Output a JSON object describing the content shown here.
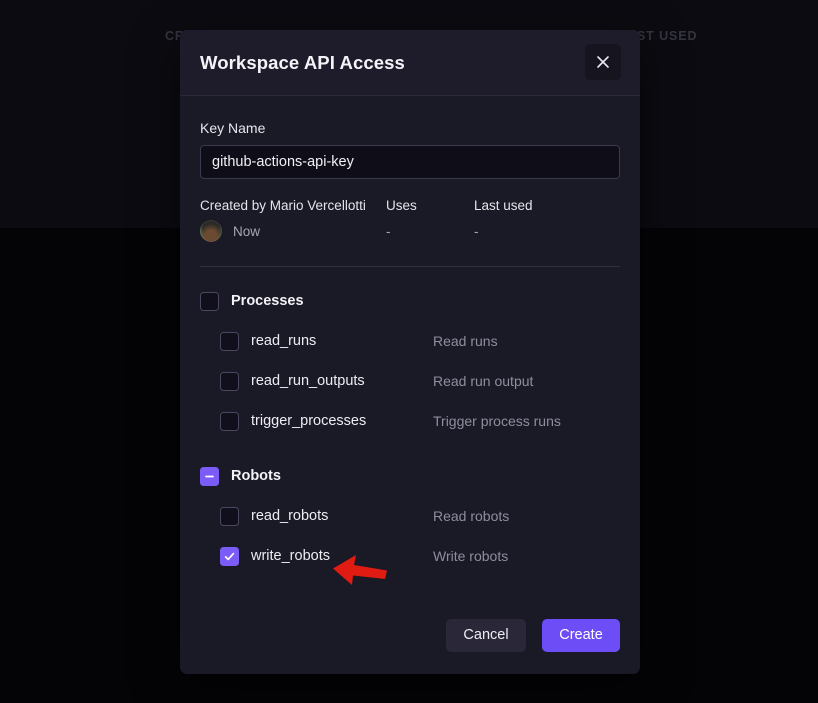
{
  "background": {
    "column_headers": [
      {
        "text": "CR",
        "name": "bg-column-created"
      },
      {
        "text": "AST USED",
        "name": "bg-column-last-used"
      }
    ]
  },
  "modal": {
    "title": "Workspace API Access",
    "close_icon": "close-icon",
    "key_name": {
      "label": "Key Name",
      "value": "github-actions-api-key",
      "placeholder": "Key Name"
    },
    "meta": {
      "created_by_label": "Created by Mario Vercellotti",
      "created_value": "Now",
      "uses_label": "Uses",
      "uses_value": "-",
      "last_used_label": "Last used",
      "last_used_value": "-"
    },
    "groups": [
      {
        "name": "Processes",
        "state": "unchecked",
        "permissions": [
          {
            "name": "read_runs",
            "description": "Read runs",
            "state": "unchecked"
          },
          {
            "name": "read_run_outputs",
            "description": "Read run output",
            "state": "unchecked"
          },
          {
            "name": "trigger_processes",
            "description": "Trigger process runs",
            "state": "unchecked"
          }
        ]
      },
      {
        "name": "Robots",
        "state": "indeterminate",
        "permissions": [
          {
            "name": "read_robots",
            "description": "Read robots",
            "state": "unchecked"
          },
          {
            "name": "write_robots",
            "description": "Write robots",
            "state": "checked"
          }
        ]
      }
    ],
    "footer": {
      "cancel_label": "Cancel",
      "create_label": "Create"
    }
  },
  "annotation": {
    "arrow_color": "#e01b12",
    "points_at": "write_robots"
  },
  "colors": {
    "accent": "#7b5cf6",
    "create_button": "#6d4df6",
    "modal_background": "#1a1926",
    "page_background": "#0b0b11",
    "page_background_lower": "#040407",
    "input_background": "#0f0e18",
    "annotation_red": "#e01b12"
  }
}
